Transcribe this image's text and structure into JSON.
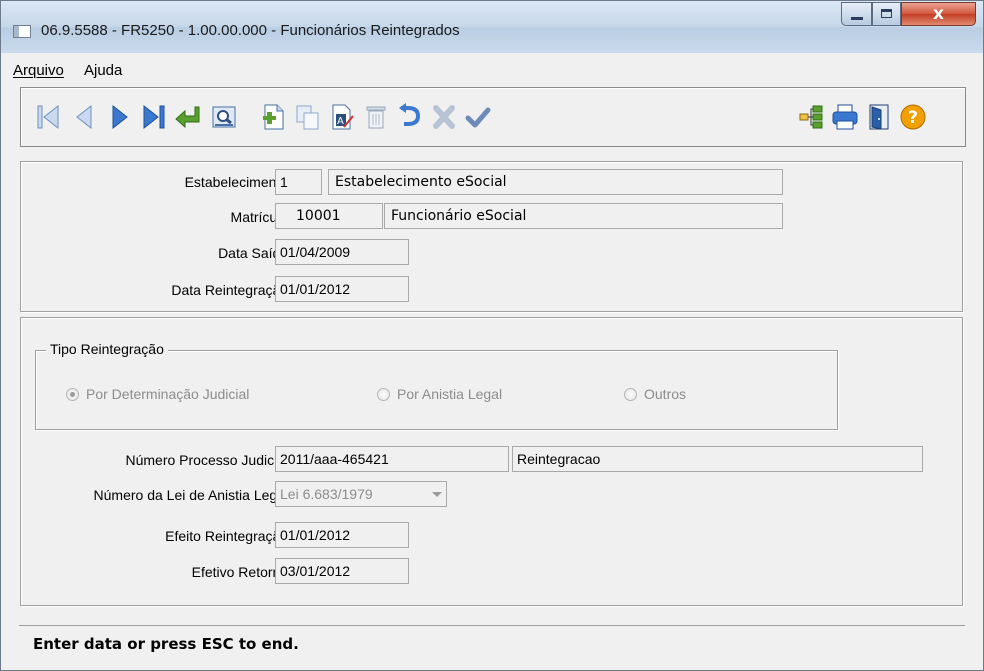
{
  "window": {
    "title": "06.9.5588 - FR5250 - 1.00.00.000 - Funcionários Reintegrados",
    "close_glyph": "x"
  },
  "menu": {
    "items": [
      "Arquivo",
      "Ajuda"
    ]
  },
  "toolbar": {
    "icons": [
      "first-record-icon",
      "prev-record-icon",
      "next-record-icon",
      "last-record-icon",
      "goto-icon",
      "search-icon",
      "add-icon",
      "copy-icon",
      "edit-icon",
      "delete-icon",
      "undo-icon",
      "cancel-icon",
      "confirm-icon",
      "tree-icon",
      "print-icon",
      "exit-icon",
      "help-icon"
    ],
    "help_glyph": "?"
  },
  "header": {
    "estabelecimento_label": "Estabelecimento:",
    "estabelecimento_code": "1",
    "estabelecimento_name": "Estabelecimento eSocial",
    "matricula_label": "Matrícula:",
    "matricula_code": "10001",
    "matricula_name": "Funcionário eSocial",
    "data_saida_label": "Data Saída:",
    "data_saida": "01/04/2009",
    "data_reintegracao_label": "Data Reintegração:",
    "data_reintegracao": "01/01/2012"
  },
  "details": {
    "tipo_group_title": "Tipo Reintegração",
    "radio_options": [
      "Por Determinação Judicial",
      "Por Anistia Legal",
      "Outros"
    ],
    "selected_option": "Por Determinação Judicial",
    "processo_label": "Número Processo Judicial:",
    "processo_numero": "2011/aaa-465421",
    "processo_desc": "Reintegracao",
    "lei_label": "Número da Lei de Anistia Legal:",
    "lei_value": "Lei 6.683/1979",
    "efeito_label": "Efeito Reintegração:",
    "efeito_value": "01/01/2012",
    "retorno_label": "Efetivo Retorno:",
    "retorno_value": "03/01/2012"
  },
  "status": {
    "text": "Enter data or press ESC to end."
  },
  "colors": {
    "nav_blue": "#2e6bbf",
    "accent_green": "#5aa031",
    "help_orange": "#f2a000"
  }
}
